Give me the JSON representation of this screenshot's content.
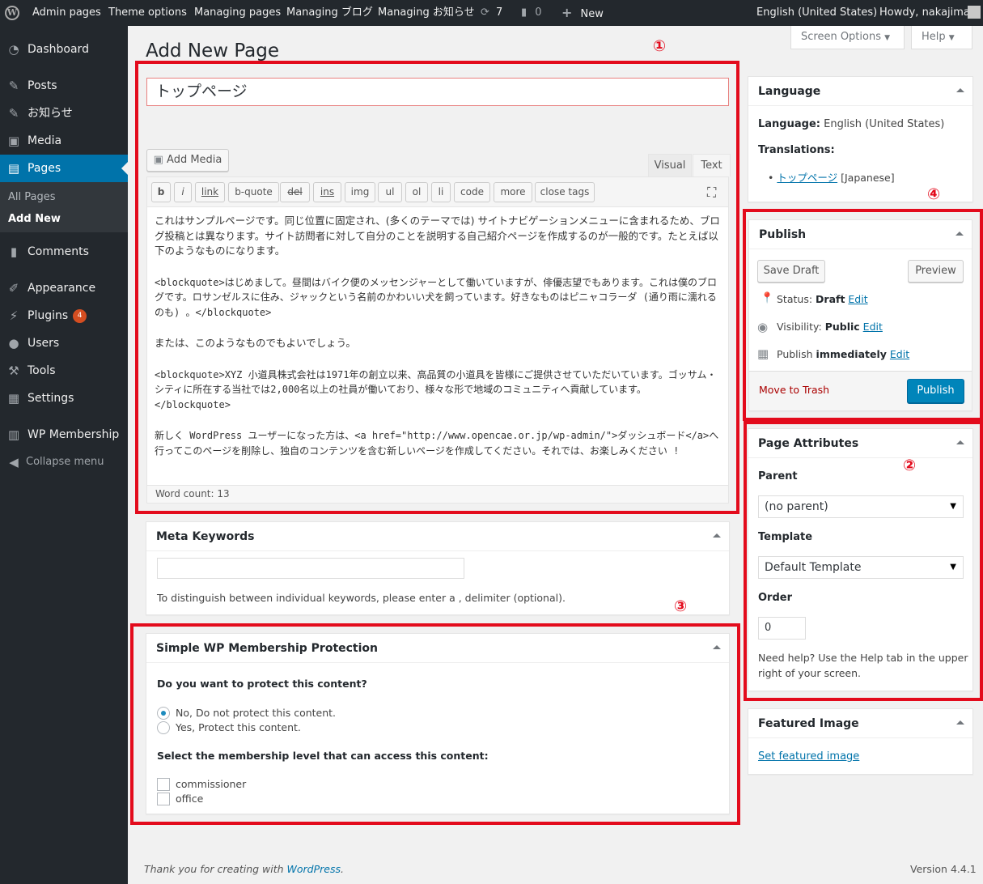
{
  "adminbar": {
    "items": [
      "Admin pages",
      "Theme options",
      "Managing pages",
      "Managing ブログ",
      "Managing お知らせ"
    ],
    "updates_count": "7",
    "comments_count": "0",
    "new_label": "New",
    "language": "English (United States)",
    "howdy": "Howdy, nakajima"
  },
  "sidebar": {
    "items": [
      {
        "label": "Dashboard",
        "icon": "dashboard-icon"
      },
      {
        "label": "Posts",
        "icon": "pin-icon"
      },
      {
        "label": "お知らせ",
        "icon": "pin-icon"
      },
      {
        "label": "Media",
        "icon": "media-icon"
      },
      {
        "label": "Pages",
        "icon": "pages-icon"
      },
      {
        "label": "Comments",
        "icon": "comment-icon"
      },
      {
        "label": "Appearance",
        "icon": "brush-icon"
      },
      {
        "label": "Plugins",
        "icon": "plugin-icon",
        "badge": "4"
      },
      {
        "label": "Users",
        "icon": "user-icon"
      },
      {
        "label": "Tools",
        "icon": "wrench-icon"
      },
      {
        "label": "Settings",
        "icon": "settings-icon"
      },
      {
        "label": "WP Membership",
        "icon": "membership-icon"
      }
    ],
    "submenu": [
      "All Pages",
      "Add New"
    ],
    "collapse": "Collapse menu"
  },
  "screen_options": "Screen Options",
  "help": "Help",
  "page_title": "Add New Page",
  "annotations": [
    "①",
    "②",
    "③",
    "④"
  ],
  "editor": {
    "title_value": "トップページ",
    "add_media": "Add Media",
    "tabs": [
      "Visual",
      "Text"
    ],
    "quicktags": [
      "b",
      "i",
      "link",
      "b-quote",
      "del",
      "ins",
      "img",
      "ul",
      "ol",
      "li",
      "code",
      "more",
      "close tags"
    ],
    "paragraphs": [
      "これはサンプルページです。同じ位置に固定され、(多くのテーマでは) サイトナビゲーションメニューに含まれるため、ブログ投稿とは異なります。サイト訪問者に対して自分のことを説明する自己紹介ページを作成するのが一般的です。たとえば以下のようなものになります。",
      "<blockquote>はじめまして。昼間はバイク便のメッセンジャーとして働いていますが、俳優志望でもあります。これは僕のブログです。ロサンゼルスに住み、ジャックという名前のかわいい犬を飼っています。好きなものはピニャコラーダ (通り雨に濡れるのも) 。</blockquote>",
      "または、このようなものでもよいでしょう。",
      "<blockquote>XYZ 小道具株式会社は1971年の創立以来、高品質の小道具を皆様にご提供させていただいています。ゴッサム・シティに所在する当社では2,000名以上の社員が働いており、様々な形で地域のコミュニティへ貢献しています。</blockquote>",
      "新しく WordPress ユーザーになった方は、<a href=\"http://www.opencae.or.jp/wp-admin/\">ダッシュボード</a>へ行ってこのページを削除し、独自のコンテンツを含む新しいページを作成してください。それでは、お楽しみください !"
    ],
    "word_count": "Word count: 13"
  },
  "meta_keywords": {
    "title": "Meta Keywords",
    "hint": "To distinguish between individual keywords, please enter a , delimiter (optional)."
  },
  "membership": {
    "title": "Simple WP Membership Protection",
    "question": "Do you want to protect this content?",
    "options": [
      "No, Do not protect this content.",
      "Yes, Protect this content."
    ],
    "level_label": "Select the membership level that can access this content:",
    "levels": [
      "commissioner",
      "office"
    ]
  },
  "language_box": {
    "title": "Language",
    "language_label": "Language:",
    "language_value": "English (United States)",
    "translations_label": "Translations:",
    "translation_link": "トップページ",
    "translation_lang": "[Japanese]"
  },
  "publish": {
    "title": "Publish",
    "save_draft": "Save Draft",
    "preview": "Preview",
    "status_label": "Status:",
    "status_value": "Draft",
    "visibility_label": "Visibility:",
    "visibility_value": "Public",
    "publish_label": "Publish",
    "publish_value": "immediately",
    "edit": "Edit",
    "trash": "Move to Trash",
    "publish_button": "Publish"
  },
  "page_attributes": {
    "title": "Page Attributes",
    "parent_label": "Parent",
    "parent_value": "(no parent)",
    "template_label": "Template",
    "template_value": "Default Template",
    "order_label": "Order",
    "order_value": "0",
    "help_line1": "Need help? Use the Help tab in the upper",
    "help_line2": "right of your screen."
  },
  "featured": {
    "title": "Featured Image",
    "link": "Set featured image"
  },
  "footer": {
    "thanks": "Thank you for creating with",
    "wp": "WordPress",
    "dot": ".",
    "version": "Version 4.4.1"
  },
  "colors": {
    "adminbar": "#23282d",
    "accent": "#0073aa",
    "highlight": "#e30b1c"
  }
}
